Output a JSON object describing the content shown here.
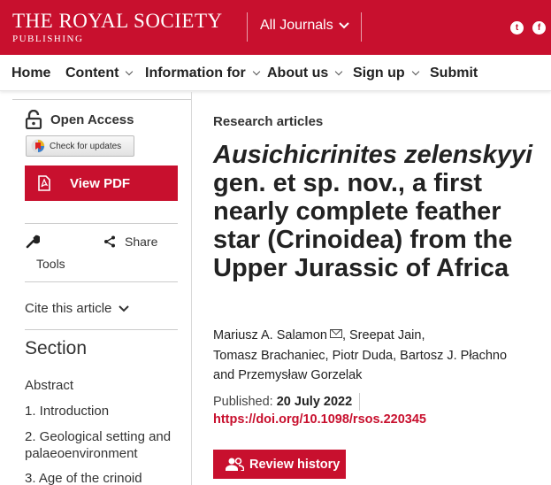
{
  "header": {
    "logo_main": "THE ROYAL SOCIETY",
    "logo_sub": "PUBLISHING",
    "journals_label": "All Journals",
    "social": {
      "twitter_glyph": "t",
      "facebook_glyph": "f"
    },
    "colors": {
      "brand_red": "#c8102e"
    }
  },
  "nav": {
    "items": [
      {
        "label": "Home"
      },
      {
        "label": "Content"
      },
      {
        "label": "Information for"
      },
      {
        "label": "About us"
      },
      {
        "label": "Sign up"
      },
      {
        "label": "Submit"
      }
    ]
  },
  "sidebar": {
    "open_access": "Open Access",
    "check_updates": "Check for updates",
    "view_pdf": "View PDF",
    "tools": "Tools",
    "share": "Share",
    "cite": "Cite this article",
    "section_title": "Section",
    "sections": [
      "Abstract",
      "1. Introduction",
      "2. Geological setting and palaeoenvironment",
      "3. Age of the crinoid"
    ]
  },
  "article": {
    "category": "Research articles",
    "title_italic": "Ausichicrinites zelenskyyi",
    "title_rest": " gen. et sp. nov., a first nearly complete feather star (Crinoidea) from the Upper Jurassic of Africa",
    "authors": {
      "a1": "Mariusz A. Salamon",
      "a2": "Sreepat Jain",
      "a3": "Tomasz Brachaniec",
      "a4": "Piotr Duda",
      "a5": "Bartosz J. Płachno",
      "and": "and",
      "a6": "Przemysław Gorzelak"
    },
    "published_label": "Published:",
    "published_date": "20 July 2022",
    "doi": "https://doi.org/10.1098/rsos.220345",
    "review_history": "Review history"
  }
}
